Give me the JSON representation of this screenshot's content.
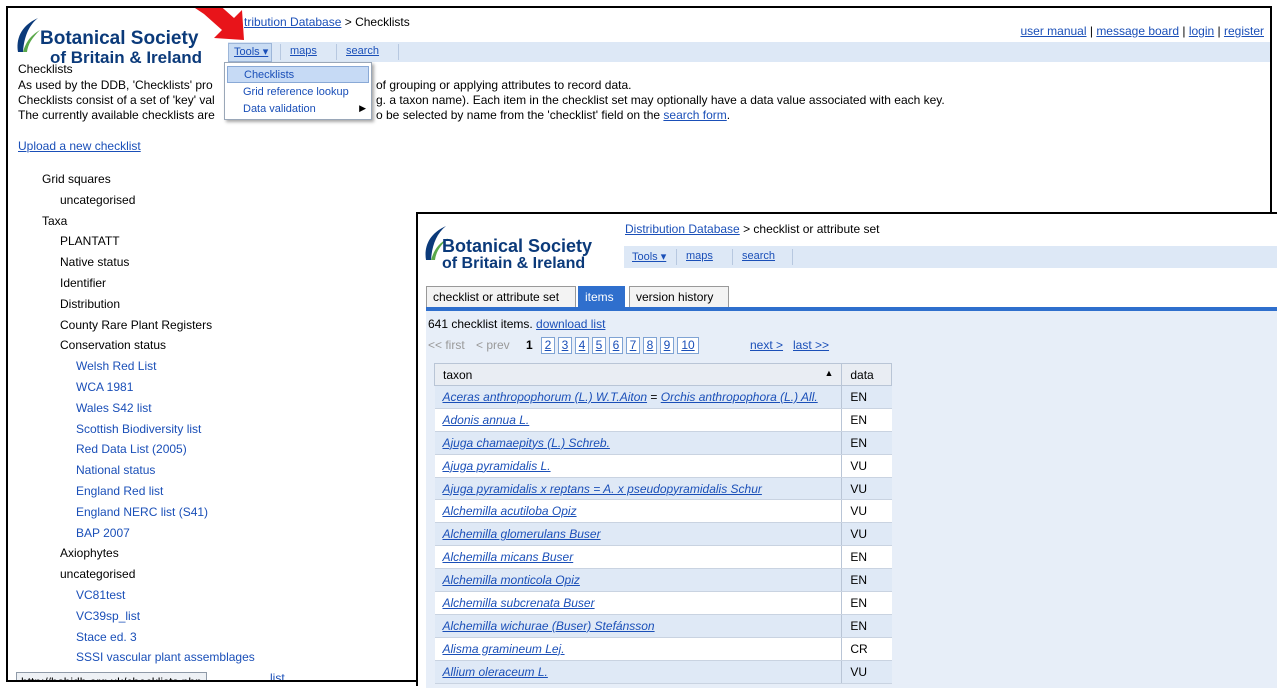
{
  "main": {
    "breadcrumb_link": "Distribution Database",
    "breadcrumb_rest": " > Checklists",
    "breadcrumb_visible_fragment": "tribution Database",
    "top_links": [
      "user manual",
      "message board",
      "login",
      "register"
    ],
    "top_sep": " | ",
    "logo_line1": "Botanical Society",
    "logo_line2": "of Britain & Ireland",
    "toolbar": {
      "tools": "Tools ▾",
      "maps": "maps",
      "search": "search"
    },
    "dropdown": [
      {
        "label": "Checklists",
        "selected": true
      },
      {
        "label": "Grid reference lookup",
        "selected": false
      },
      {
        "label": "Data validation",
        "selected": false,
        "submenu": true
      }
    ],
    "heading": "Checklists",
    "para_visible": [
      "As used by the DDB, 'Checklists' pro",
      "Checklists consist of a set of 'key' val",
      "The currently available checklists are"
    ],
    "para_right": [
      "of grouping or applying attributes to record data.",
      "g. a taxon name). Each item in the checklist set may optionally have a data value associated with each key.",
      "o be selected by name from the 'checklist' field on the "
    ],
    "search_form_link": "search form",
    "period": ".",
    "upload_link": "Upload a new checklist",
    "tree": [
      {
        "label": "Grid squares",
        "level": 1,
        "blue": false
      },
      {
        "label": "uncategorised",
        "level": 2,
        "blue": false
      },
      {
        "label": "Taxa",
        "level": 1,
        "blue": false
      },
      {
        "label": "PLANTATT",
        "level": 2,
        "blue": false
      },
      {
        "label": "Native status",
        "level": 2,
        "blue": false
      },
      {
        "label": "Identifier",
        "level": 2,
        "blue": false
      },
      {
        "label": "Distribution",
        "level": 2,
        "blue": false
      },
      {
        "label": "County Rare Plant Registers",
        "level": 2,
        "blue": false
      },
      {
        "label": "Conservation status",
        "level": 2,
        "blue": false
      },
      {
        "label": "Welsh Red List",
        "level": 3,
        "blue": true
      },
      {
        "label": "WCA 1981",
        "level": 3,
        "blue": true
      },
      {
        "label": "Wales S42 list",
        "level": 3,
        "blue": true
      },
      {
        "label": "Scottish Biodiversity list",
        "level": 3,
        "blue": true
      },
      {
        "label": "Red Data List (2005)",
        "level": 3,
        "blue": true
      },
      {
        "label": "National status",
        "level": 3,
        "blue": true
      },
      {
        "label": "England Red list",
        "level": 3,
        "blue": true
      },
      {
        "label": "England NERC list (S41)",
        "level": 3,
        "blue": true
      },
      {
        "label": "BAP 2007",
        "level": 3,
        "blue": true
      },
      {
        "label": "Axiophytes",
        "level": 2,
        "blue": false
      },
      {
        "label": "uncategorised",
        "level": 2,
        "blue": false
      },
      {
        "label": "VC81test",
        "level": 3,
        "blue": true
      },
      {
        "label": "VC39sp_list",
        "level": 3,
        "blue": true
      },
      {
        "label": "Stace ed. 3",
        "level": 3,
        "blue": true
      },
      {
        "label": "SSSI vascular plant assemblages",
        "level": 3,
        "blue": true
      },
      {
        "label": "list",
        "level": 3,
        "blue": true
      }
    ],
    "status_url": "http://bsbidb.org.uk/checklists.php"
  },
  "panel2": {
    "breadcrumb_link": "Distribution Database",
    "breadcrumb_rest": " > checklist or attribute set",
    "logo_line1": "Botanical Society",
    "logo_line2": "of Britain & Ireland",
    "toolbar": {
      "tools": "Tools ▾",
      "maps": "maps",
      "search": "search"
    },
    "tabs": [
      {
        "label": "checklist or attribute set",
        "active": false
      },
      {
        "label": "items",
        "active": true
      },
      {
        "label": "version history",
        "active": false
      }
    ],
    "count_text": "641 checklist items. ",
    "download_link": "download list",
    "pager": {
      "first": "<< first",
      "prev": "< prev",
      "current": "1",
      "pages": [
        "2",
        "3",
        "4",
        "5",
        "6",
        "7",
        "8",
        "9",
        "10"
      ],
      "next": "next >",
      "last": "last >>"
    },
    "table": {
      "col_taxon": "taxon",
      "sort_icon": "▲",
      "col_data": "data",
      "rows": [
        {
          "taxon": "Aceras anthropophorum (L.) W.T.Aiton",
          "syn": "Orchis anthropophora (L.) All.",
          "data": "EN"
        },
        {
          "taxon": "Adonis annua L.",
          "data": "EN"
        },
        {
          "taxon": "Ajuga chamaepitys (L.) Schreb.",
          "data": "EN"
        },
        {
          "taxon": "Ajuga pyramidalis L.",
          "data": "VU"
        },
        {
          "taxon": "Ajuga pyramidalis x reptans = A. x pseudopyramidalis Schur",
          "data": "VU"
        },
        {
          "taxon": "Alchemilla acutiloba Opiz",
          "data": "VU"
        },
        {
          "taxon": "Alchemilla glomerulans Buser",
          "data": "VU"
        },
        {
          "taxon": "Alchemilla micans Buser",
          "data": "EN"
        },
        {
          "taxon": "Alchemilla monticola Opiz",
          "data": "EN"
        },
        {
          "taxon": "Alchemilla subcrenata Buser",
          "data": "EN"
        },
        {
          "taxon": "Alchemilla wichurae (Buser) Stefánsson",
          "data": "EN"
        },
        {
          "taxon": "Alisma gramineum Lej.",
          "data": "CR"
        },
        {
          "taxon": "Allium oleraceum L.",
          "data": "VU"
        }
      ]
    }
  },
  "colors": {
    "arrow": "#e8141a",
    "link": "#1a4fb8",
    "logo": "#0b3a7a",
    "tab_active": "#2f6fcd",
    "toolbar": "#dde8f6"
  }
}
